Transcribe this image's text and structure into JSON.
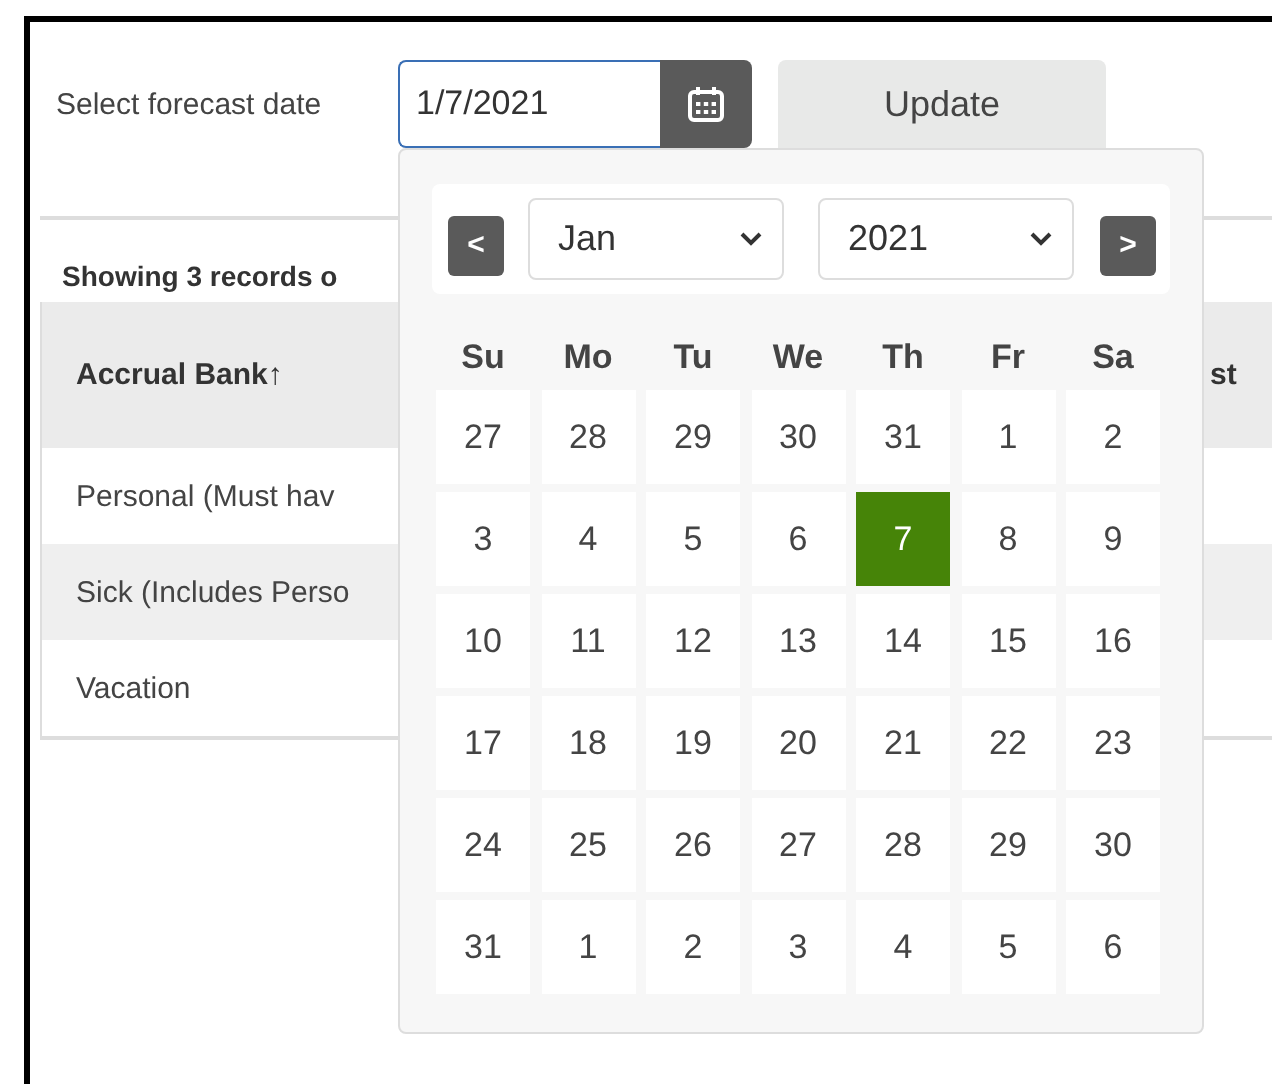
{
  "forecast": {
    "label": "Select forecast date",
    "value": "1/7/2021",
    "button": "Update"
  },
  "records_summary": "Showing 3 records o",
  "table": {
    "columns": [
      "Accrual Bank↑",
      "st"
    ],
    "rows": [
      [
        "Personal (Must hav"
      ],
      [
        "Sick (Includes Perso"
      ],
      [
        "Vacation"
      ]
    ]
  },
  "datepicker": {
    "prev": "<",
    "next": ">",
    "month": "Jan",
    "year": "2021",
    "weekdays": [
      "Su",
      "Mo",
      "Tu",
      "We",
      "Th",
      "Fr",
      "Sa"
    ],
    "days": [
      {
        "label": "27",
        "selected": false
      },
      {
        "label": "28",
        "selected": false
      },
      {
        "label": "29",
        "selected": false
      },
      {
        "label": "30",
        "selected": false
      },
      {
        "label": "31",
        "selected": false
      },
      {
        "label": "1",
        "selected": false
      },
      {
        "label": "2",
        "selected": false
      },
      {
        "label": "3",
        "selected": false
      },
      {
        "label": "4",
        "selected": false
      },
      {
        "label": "5",
        "selected": false
      },
      {
        "label": "6",
        "selected": false
      },
      {
        "label": "7",
        "selected": true
      },
      {
        "label": "8",
        "selected": false
      },
      {
        "label": "9",
        "selected": false
      },
      {
        "label": "10",
        "selected": false
      },
      {
        "label": "11",
        "selected": false
      },
      {
        "label": "12",
        "selected": false
      },
      {
        "label": "13",
        "selected": false
      },
      {
        "label": "14",
        "selected": false
      },
      {
        "label": "15",
        "selected": false
      },
      {
        "label": "16",
        "selected": false
      },
      {
        "label": "17",
        "selected": false
      },
      {
        "label": "18",
        "selected": false
      },
      {
        "label": "19",
        "selected": false
      },
      {
        "label": "20",
        "selected": false
      },
      {
        "label": "21",
        "selected": false
      },
      {
        "label": "22",
        "selected": false
      },
      {
        "label": "23",
        "selected": false
      },
      {
        "label": "24",
        "selected": false
      },
      {
        "label": "25",
        "selected": false
      },
      {
        "label": "26",
        "selected": false
      },
      {
        "label": "27",
        "selected": false
      },
      {
        "label": "28",
        "selected": false
      },
      {
        "label": "29",
        "selected": false
      },
      {
        "label": "30",
        "selected": false
      },
      {
        "label": "31",
        "selected": false
      },
      {
        "label": "1",
        "selected": false
      },
      {
        "label": "2",
        "selected": false
      },
      {
        "label": "3",
        "selected": false
      },
      {
        "label": "4",
        "selected": false
      },
      {
        "label": "5",
        "selected": false
      },
      {
        "label": "6",
        "selected": false
      }
    ]
  }
}
